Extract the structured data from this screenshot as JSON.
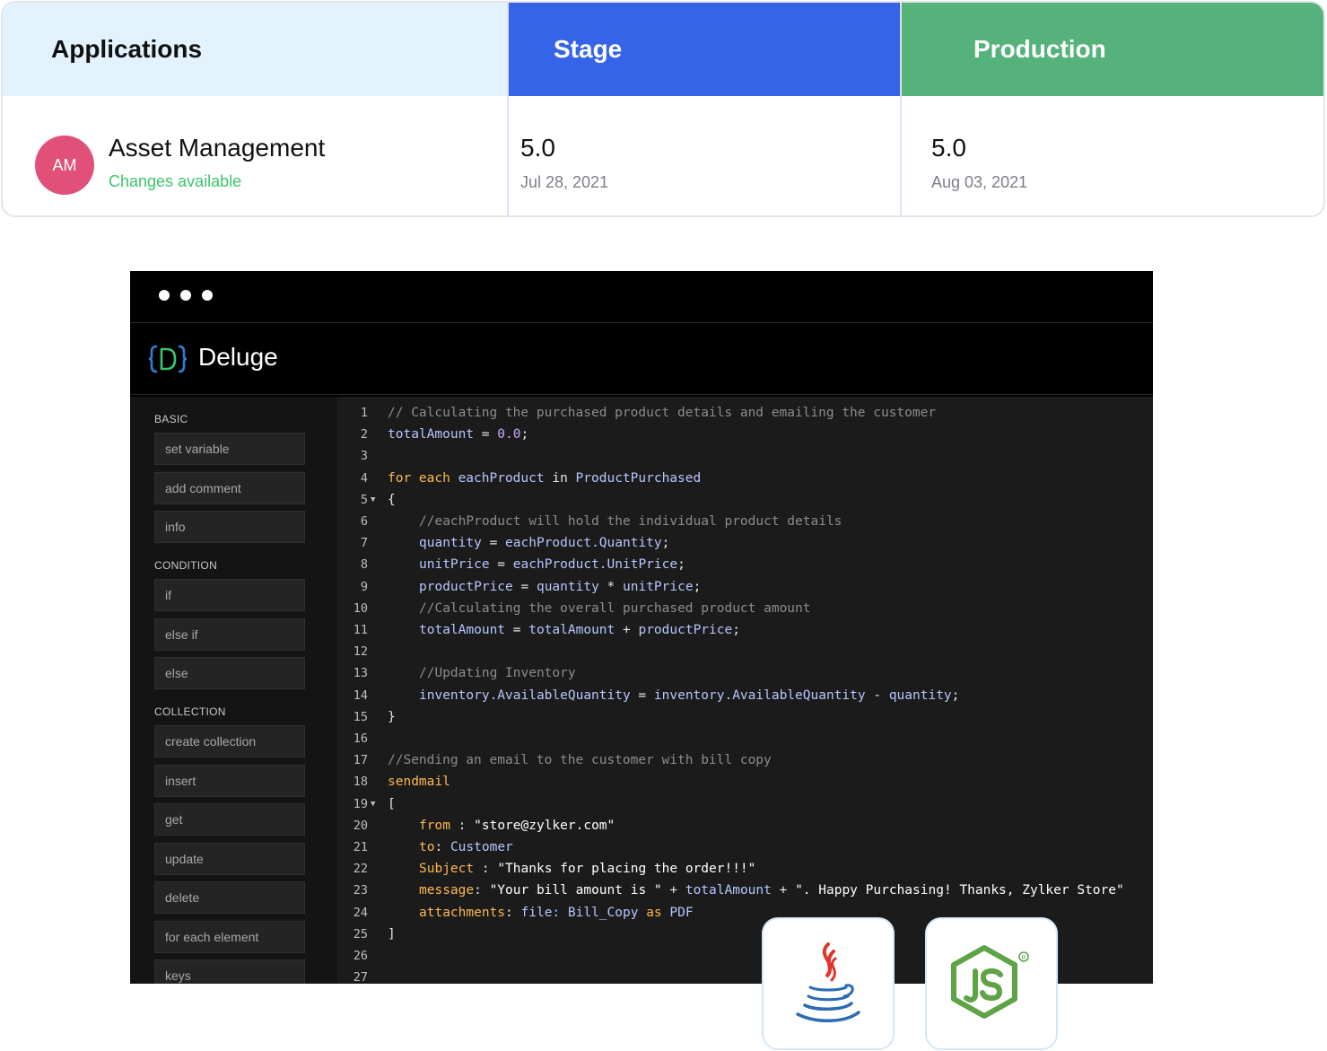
{
  "deploy": {
    "headers": {
      "apps": "Applications",
      "stage": "Stage",
      "production": "Production"
    },
    "app": {
      "initials": "AM",
      "name": "Asset Management",
      "status": "Changes available"
    },
    "stage": {
      "version": "5.0",
      "date": "Jul 28, 2021"
    },
    "production": {
      "version": "5.0",
      "date": "Aug 03, 2021"
    },
    "colors": {
      "stage": "#3664e8",
      "production": "#54b27a",
      "apps_header": "#e3f3fd",
      "avatar": "#e05078",
      "status": "#3cc46c"
    }
  },
  "editor": {
    "brand": "Deluge",
    "sidebar": {
      "sections": [
        {
          "label": "BASIC",
          "items": [
            "set variable",
            "add comment",
            "info"
          ]
        },
        {
          "label": "CONDITION",
          "items": [
            "if",
            "else if",
            "else"
          ]
        },
        {
          "label": "COLLECTION",
          "items": [
            "create collection",
            "insert",
            "get",
            "update",
            "delete",
            "for each element",
            "keys"
          ]
        }
      ]
    },
    "code": [
      {
        "n": "1",
        "fold": false,
        "indent": 0,
        "tokens": [
          [
            "comment",
            "// Calculating the purchased product details and emailing the customer"
          ]
        ]
      },
      {
        "n": "2",
        "fold": false,
        "indent": 0,
        "tokens": [
          [
            "var",
            "totalAmount"
          ],
          [
            "punct",
            " = "
          ],
          [
            "num",
            "0.0"
          ],
          [
            "punct",
            ";"
          ]
        ]
      },
      {
        "n": "3",
        "fold": false,
        "indent": 0,
        "tokens": []
      },
      {
        "n": "4",
        "fold": false,
        "indent": 0,
        "tokens": [
          [
            "kw",
            "for each"
          ],
          [
            "var",
            " eachProduct "
          ],
          [
            "punct",
            "in"
          ],
          [
            "var",
            " ProductPurchased"
          ]
        ]
      },
      {
        "n": "5",
        "fold": true,
        "indent": 0,
        "tokens": [
          [
            "punct",
            "{"
          ]
        ]
      },
      {
        "n": "6",
        "fold": false,
        "indent": 1,
        "tokens": [
          [
            "comment",
            "//eachProduct will hold the individual product details"
          ]
        ]
      },
      {
        "n": "7",
        "fold": false,
        "indent": 1,
        "tokens": [
          [
            "var",
            "quantity"
          ],
          [
            "punct",
            " = "
          ],
          [
            "var",
            "eachProduct.Quantity"
          ],
          [
            "punct",
            ";"
          ]
        ]
      },
      {
        "n": "8",
        "fold": false,
        "indent": 1,
        "tokens": [
          [
            "var",
            "unitPrice"
          ],
          [
            "punct",
            " = "
          ],
          [
            "var",
            "eachProduct.UnitPrice"
          ],
          [
            "punct",
            ";"
          ]
        ]
      },
      {
        "n": "9",
        "fold": false,
        "indent": 1,
        "tokens": [
          [
            "var",
            "productPrice"
          ],
          [
            "punct",
            " = "
          ],
          [
            "var",
            "quantity"
          ],
          [
            "punct",
            " * "
          ],
          [
            "var",
            "unitPrice"
          ],
          [
            "punct",
            ";"
          ]
        ]
      },
      {
        "n": "10",
        "fold": false,
        "indent": 1,
        "tokens": [
          [
            "comment",
            "//Calculating the overall purchased product amount"
          ]
        ]
      },
      {
        "n": "11",
        "fold": false,
        "indent": 1,
        "tokens": [
          [
            "var",
            "totalAmount"
          ],
          [
            "punct",
            " = "
          ],
          [
            "var",
            "totalAmount"
          ],
          [
            "punct",
            " + "
          ],
          [
            "var",
            "productPrice"
          ],
          [
            "punct",
            ";"
          ]
        ]
      },
      {
        "n": "12",
        "fold": false,
        "indent": 0,
        "tokens": []
      },
      {
        "n": "13",
        "fold": false,
        "indent": 1,
        "tokens": [
          [
            "comment",
            "//Updating Inventory"
          ]
        ]
      },
      {
        "n": "14",
        "fold": false,
        "indent": 1,
        "tokens": [
          [
            "var",
            "inventory.AvailableQuantity"
          ],
          [
            "punct",
            " = "
          ],
          [
            "var",
            "inventory.AvailableQuantity"
          ],
          [
            "punct",
            " - "
          ],
          [
            "var",
            "quantity"
          ],
          [
            "punct",
            ";"
          ]
        ]
      },
      {
        "n": "15",
        "fold": false,
        "indent": 0,
        "tokens": [
          [
            "punct",
            "}"
          ]
        ]
      },
      {
        "n": "16",
        "fold": false,
        "indent": 0,
        "tokens": []
      },
      {
        "n": "17",
        "fold": false,
        "indent": 0,
        "tokens": [
          [
            "comment",
            "//Sending an email to the customer with bill copy"
          ]
        ]
      },
      {
        "n": "18",
        "fold": false,
        "indent": 0,
        "tokens": [
          [
            "kw",
            "sendmail"
          ]
        ]
      },
      {
        "n": "19",
        "fold": true,
        "indent": 0,
        "tokens": [
          [
            "punct",
            "["
          ]
        ]
      },
      {
        "n": "20",
        "fold": false,
        "indent": 1,
        "tokens": [
          [
            "kw",
            "from"
          ],
          [
            "punct",
            " : "
          ],
          [
            "str",
            "\"store@zylker.com\""
          ]
        ]
      },
      {
        "n": "21",
        "fold": false,
        "indent": 1,
        "tokens": [
          [
            "kw",
            "to"
          ],
          [
            "punct",
            ": "
          ],
          [
            "var",
            "Customer"
          ]
        ]
      },
      {
        "n": "22",
        "fold": false,
        "indent": 1,
        "tokens": [
          [
            "kw",
            "Subject"
          ],
          [
            "punct",
            " : "
          ],
          [
            "str",
            "\"Thanks for placing the order!!!\""
          ]
        ]
      },
      {
        "n": "23",
        "fold": false,
        "indent": 1,
        "tokens": [
          [
            "kw",
            "message"
          ],
          [
            "punct",
            ": "
          ],
          [
            "str",
            "\"Your bill amount is \""
          ],
          [
            "punct",
            " + "
          ],
          [
            "var",
            "totalAmount"
          ],
          [
            "punct",
            " + "
          ],
          [
            "str",
            "\". Happy Purchasing! Thanks, Zylker Store\""
          ]
        ]
      },
      {
        "n": "24",
        "fold": false,
        "indent": 1,
        "tokens": [
          [
            "kw",
            "attachments"
          ],
          [
            "punct",
            ": "
          ],
          [
            "var",
            "file: Bill_Copy "
          ],
          [
            "kw",
            "as"
          ],
          [
            "var",
            " PDF"
          ]
        ]
      },
      {
        "n": "25",
        "fold": false,
        "indent": 0,
        "tokens": [
          [
            "punct",
            "]"
          ]
        ]
      },
      {
        "n": "26",
        "fold": false,
        "indent": 0,
        "tokens": []
      },
      {
        "n": "27",
        "fold": false,
        "indent": 0,
        "tokens": []
      }
    ]
  },
  "badges": [
    {
      "name": "java-logo-icon"
    },
    {
      "name": "nodejs-logo-icon"
    }
  ]
}
